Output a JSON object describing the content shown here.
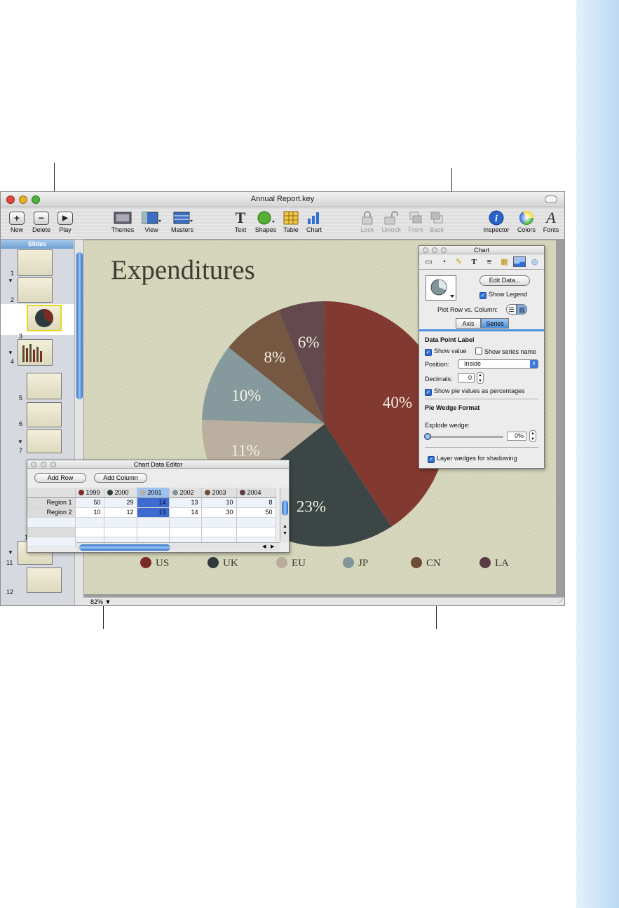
{
  "window": {
    "title": "Annual Report.key"
  },
  "toolbar": {
    "new": "New",
    "delete": "Delete",
    "play": "Play",
    "themes": "Themes",
    "view": "View",
    "masters": "Masters",
    "text": "Text",
    "shapes": "Shapes",
    "table": "Table",
    "chart": "Chart",
    "lock": "Lock",
    "unlock": "Unlock",
    "front": "Front",
    "back": "Back",
    "inspector": "Inspector",
    "colors": "Colors",
    "fonts": "Fonts"
  },
  "slides_panel": {
    "header": "Slides",
    "numbers": [
      "1",
      "2",
      "3",
      "4",
      "5",
      "6",
      "7",
      "1",
      "11",
      "12"
    ]
  },
  "slide": {
    "title": "Expenditures",
    "pie_labels": [
      "40%",
      "23%",
      "11%",
      "10%",
      "8%",
      "6%"
    ]
  },
  "status": {
    "zoom": "82%"
  },
  "legend": [
    "US",
    "UK",
    "EU",
    "JP",
    "CN",
    "LA"
  ],
  "colors": {
    "US": "#7b2b25",
    "UK": "#2f3a3c",
    "EU": "#b9ad9c",
    "JP": "#7f959a",
    "CN": "#6e4d37",
    "LA": "#5a3d44"
  },
  "chart_data": {
    "type": "pie",
    "title": "Expenditures",
    "categories": [
      "US",
      "UK",
      "EU",
      "JP",
      "CN",
      "LA"
    ],
    "values": [
      40,
      23,
      11,
      10,
      8,
      6
    ],
    "legend": "bottom"
  },
  "inspector": {
    "title": "Chart",
    "edit_data": "Edit Data...",
    "show_legend": "Show Legend",
    "plot_row_vs_column": "Plot Row vs. Column:",
    "tab_axis": "Axis",
    "tab_series": "Series",
    "data_point_label": "Data Point Label",
    "show_value": "Show value",
    "show_series_name": "Show series name",
    "position_label": "Position:",
    "position_value": "Inside",
    "decimals_label": "Decimals:",
    "decimals_value": "0",
    "show_pie_pct": "Show pie values as percentages",
    "pie_wedge_format": "Pie Wedge Format",
    "explode_wedge": "Explode wedge:",
    "explode_value": "0%",
    "layer_wedges": "Layer wedges for shadowing"
  },
  "data_editor": {
    "title": "Chart Data Editor",
    "add_row": "Add Row",
    "add_column": "Add Column",
    "columns": [
      "1999",
      "2000",
      "2001",
      "2002",
      "2003",
      "2004"
    ],
    "rows": [
      {
        "label": "Region 1",
        "values": [
          "50",
          "29",
          "14",
          "13",
          "10",
          "8"
        ]
      },
      {
        "label": "Region 2",
        "values": [
          "10",
          "12",
          "13",
          "14",
          "30",
          "50"
        ]
      }
    ]
  }
}
